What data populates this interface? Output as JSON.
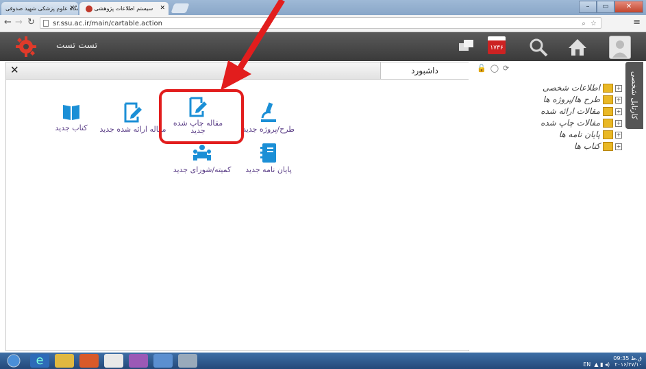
{
  "browser": {
    "tabs": [
      {
        "label": "دانشگاه علوم پزشکی شهید صدوقی",
        "active": false
      },
      {
        "label": "سیستم اطلاعات پژوهشی",
        "active": true
      }
    ],
    "url": "sr.ssu.ac.ir/main/cartable.action"
  },
  "header": {
    "app_name": "تست تست",
    "badge_count": "۱۷۳۶",
    "icons": [
      "windows-icon",
      "mail-icon",
      "search-icon",
      "home-icon",
      "avatar"
    ]
  },
  "dashboard": {
    "tab_label": "داشبورد",
    "close_label": "✕",
    "tiles": [
      {
        "label": "کتاب جدید",
        "icon": "book-icon"
      },
      {
        "label": "مقاله ارائه شده جدید",
        "icon": "edit-doc-icon"
      },
      {
        "label": "مقاله چاپ شده جدید",
        "icon": "edit-doc-icon"
      },
      {
        "label": "طرح/پروژه جدید",
        "icon": "microscope-icon"
      },
      {
        "label": "کمیته/شورای جدید",
        "icon": "committee-icon"
      },
      {
        "label": "پایان نامه جدید",
        "icon": "notebook-icon"
      }
    ]
  },
  "sidebar": {
    "vertical_tab": "کارتابل شخصی",
    "tree": [
      {
        "label": "اطلاعات شخصی"
      },
      {
        "label": "طرح ها/پروژه ها"
      },
      {
        "label": "مقالات ارائه شده"
      },
      {
        "label": "مقالات چاپ شده"
      },
      {
        "label": "پایان نامه ها"
      },
      {
        "label": "کتاب ها"
      }
    ]
  },
  "taskbar": {
    "lang": "EN",
    "time": "09:35 ق.ظ",
    "date": "۲۰۱۶/۲۷/۱۰"
  },
  "colors": {
    "accent_red": "#e21d1d",
    "tile_blue": "#1b8fd6",
    "header_dark": "#4a4a4a"
  }
}
